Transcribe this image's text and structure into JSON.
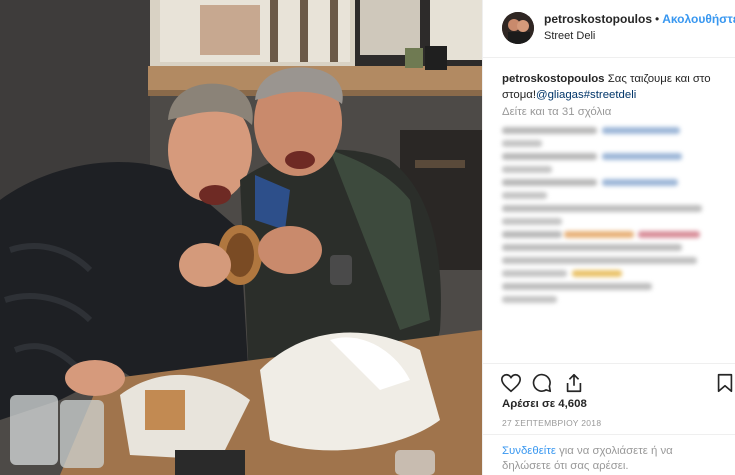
{
  "post": {
    "photo_alt": "petroskostopoulos post photo"
  },
  "header": {
    "username": "petroskostopoulos",
    "separator": "•",
    "follow_label": "Ακολουθήστε",
    "location": "Street Deli"
  },
  "caption": {
    "username": "petroskostopoulos",
    "text": "Σας ταιζουμε και στο στομα!",
    "mention": "@gliagas",
    "hashtag": "#streetdeli"
  },
  "comments": {
    "view_all_label": "Δείτε και τα 31 σχόλια"
  },
  "actions": {
    "like_icon": "heart-icon",
    "comment_icon": "comment-icon",
    "share_icon": "share-icon",
    "save_icon": "bookmark-icon"
  },
  "likes": {
    "label": "Αρέσει σε 4,608"
  },
  "date": {
    "label": "27 ΣΕΠΤΕΜΒΡΙΟΥ 2018"
  },
  "login_prompt": {
    "link_label": "Συνδεθείτε",
    "text": " για να σχολιάσετε ή να δηλώσετε ότι σας αρέσει."
  },
  "colors": {
    "accent": "#3897f0",
    "link": "#003569",
    "muted": "#999999",
    "text": "#262626",
    "border": "#efefef"
  }
}
